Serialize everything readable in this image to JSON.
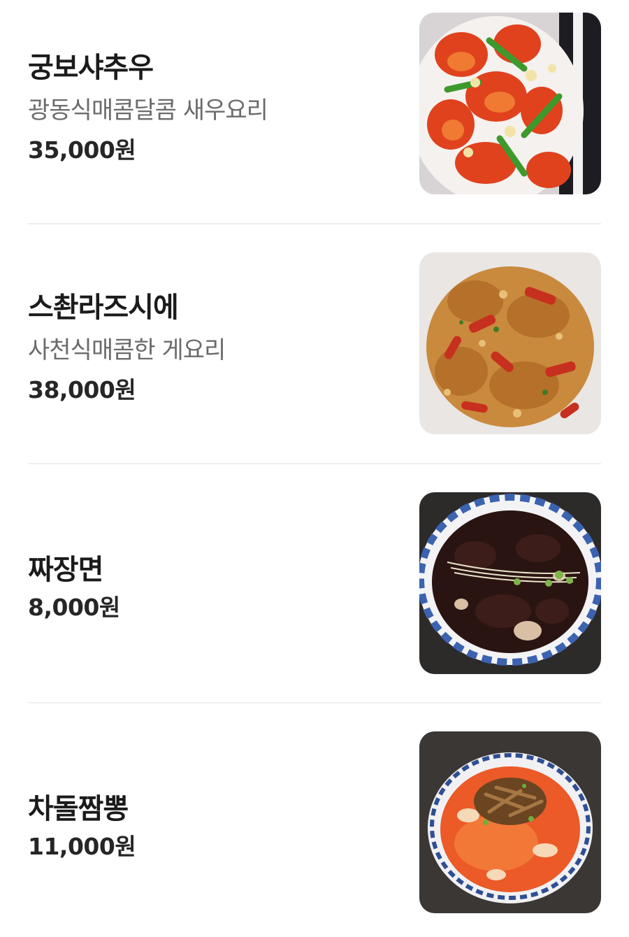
{
  "menu": {
    "items": [
      {
        "name": "궁보샤추우",
        "description": "광동식매콤달콤 새우요리",
        "price": "35,000원",
        "image": "kung-pao-shrimp-photo"
      },
      {
        "name": "스촨라즈시에",
        "description": "사천식매콤한 게요리",
        "price": "38,000원",
        "image": "sichuan-spicy-crab-photo"
      },
      {
        "name": "짜장면",
        "price": "8,000원",
        "image": "jajangmyeon-photo"
      },
      {
        "name": "차돌짬뽕",
        "price": "11,000원",
        "image": "brisket-jjamppong-photo"
      }
    ]
  }
}
